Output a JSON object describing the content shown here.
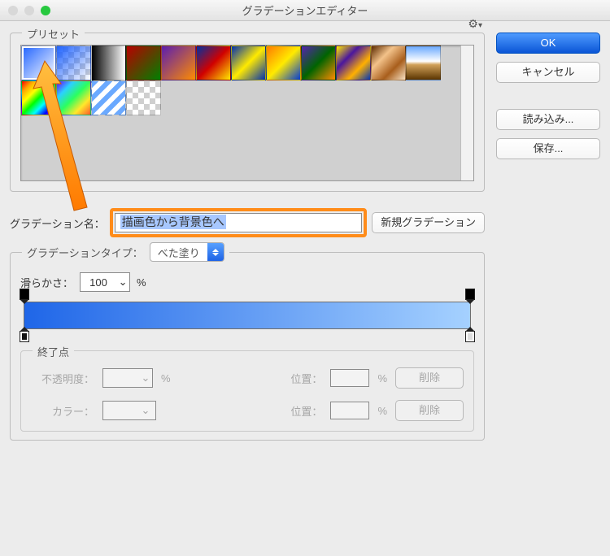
{
  "window": {
    "title": "グラデーションエディター"
  },
  "buttons": {
    "ok": "OK",
    "cancel": "キャンセル",
    "load": "読み込み...",
    "save": "保存...",
    "new_gradient": "新規グラデーション",
    "delete": "削除"
  },
  "presets": {
    "legend": "プリセット",
    "gear_icon": "⚙",
    "gear_caret": "▾"
  },
  "name": {
    "label": "グラデーション名：",
    "value": "描画色から背景色へ"
  },
  "gradient": {
    "type_label": "グラデーションタイプ：",
    "type_value": "べた塗り",
    "smooth_label": "滑らかさ：",
    "smooth_value": "100",
    "percent": "%"
  },
  "stops": {
    "legend": "終了点",
    "opacity_label": "不透明度：",
    "color_label": "カラー：",
    "position_label": "位置：",
    "percent": "%"
  }
}
